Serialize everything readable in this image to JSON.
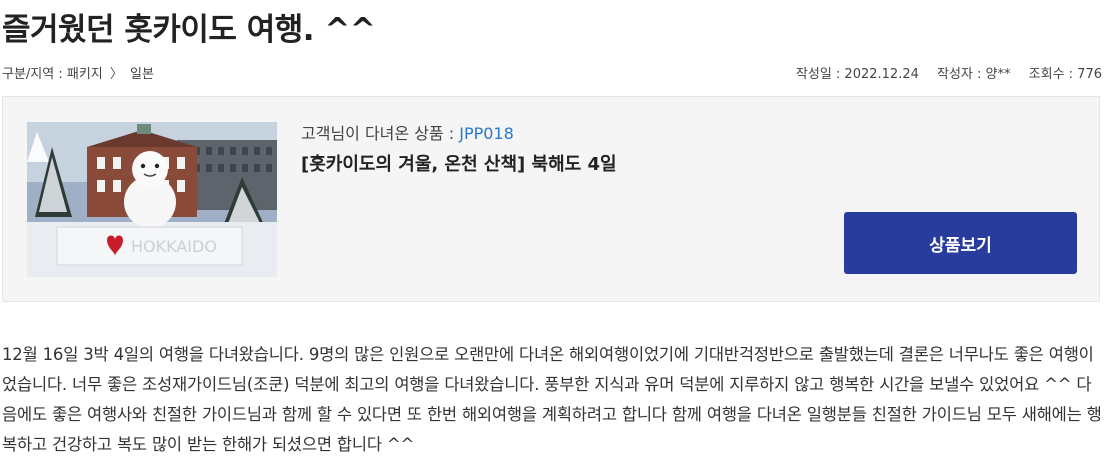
{
  "post": {
    "title": "즐거웠던 홋카이도 여행. ^^"
  },
  "meta": {
    "category_label": "구분/지역 : 패키지",
    "category_separator": "〉",
    "region": "일본",
    "date": "작성일 : 2022.12.24",
    "author": "작성자 : 양**",
    "views": "조회수 : 776"
  },
  "product": {
    "visited_prefix": "고객님이 다녀온 상품 : ",
    "code": "JPP018",
    "name": "[홋카이도의 겨울, 온천 산책] 북해도 4일",
    "view_button_label": "상품보기",
    "image_icon": "snowman-hokkaido-photo"
  },
  "review": {
    "body": "12월 16일 3박 4일의 여행을 다녀왔습니다. 9명의 많은 인원으로 오랜만에 다녀온 해외여행이었기에 기대반걱정반으로 출발했는데 결론은 너무나도 좋은 여행이었습니다. 너무 좋은 조성재가이드님(조쿤) 덕분에 최고의 여행을 다녀왔습니다. 풍부한 지식과 유머 덕분에 지루하지 않고 행복한 시간을 보낼수 있었어요 ^^  다음에도 좋은 여행사와 친절한 가이드님과 함께 할 수 있다면 또 한번 해외여행을 계획하려고 합니다 함께 여행을 다녀온 일행분들 친절한 가이드님 모두 새해에는 행복하고 건강하고 복도 많이 받는 한해가 되셨으면 합니다 ^^"
  },
  "colors": {
    "button_bg": "#283c9e",
    "code_link": "#2a78c8",
    "box_bg": "#f5f5f5"
  }
}
